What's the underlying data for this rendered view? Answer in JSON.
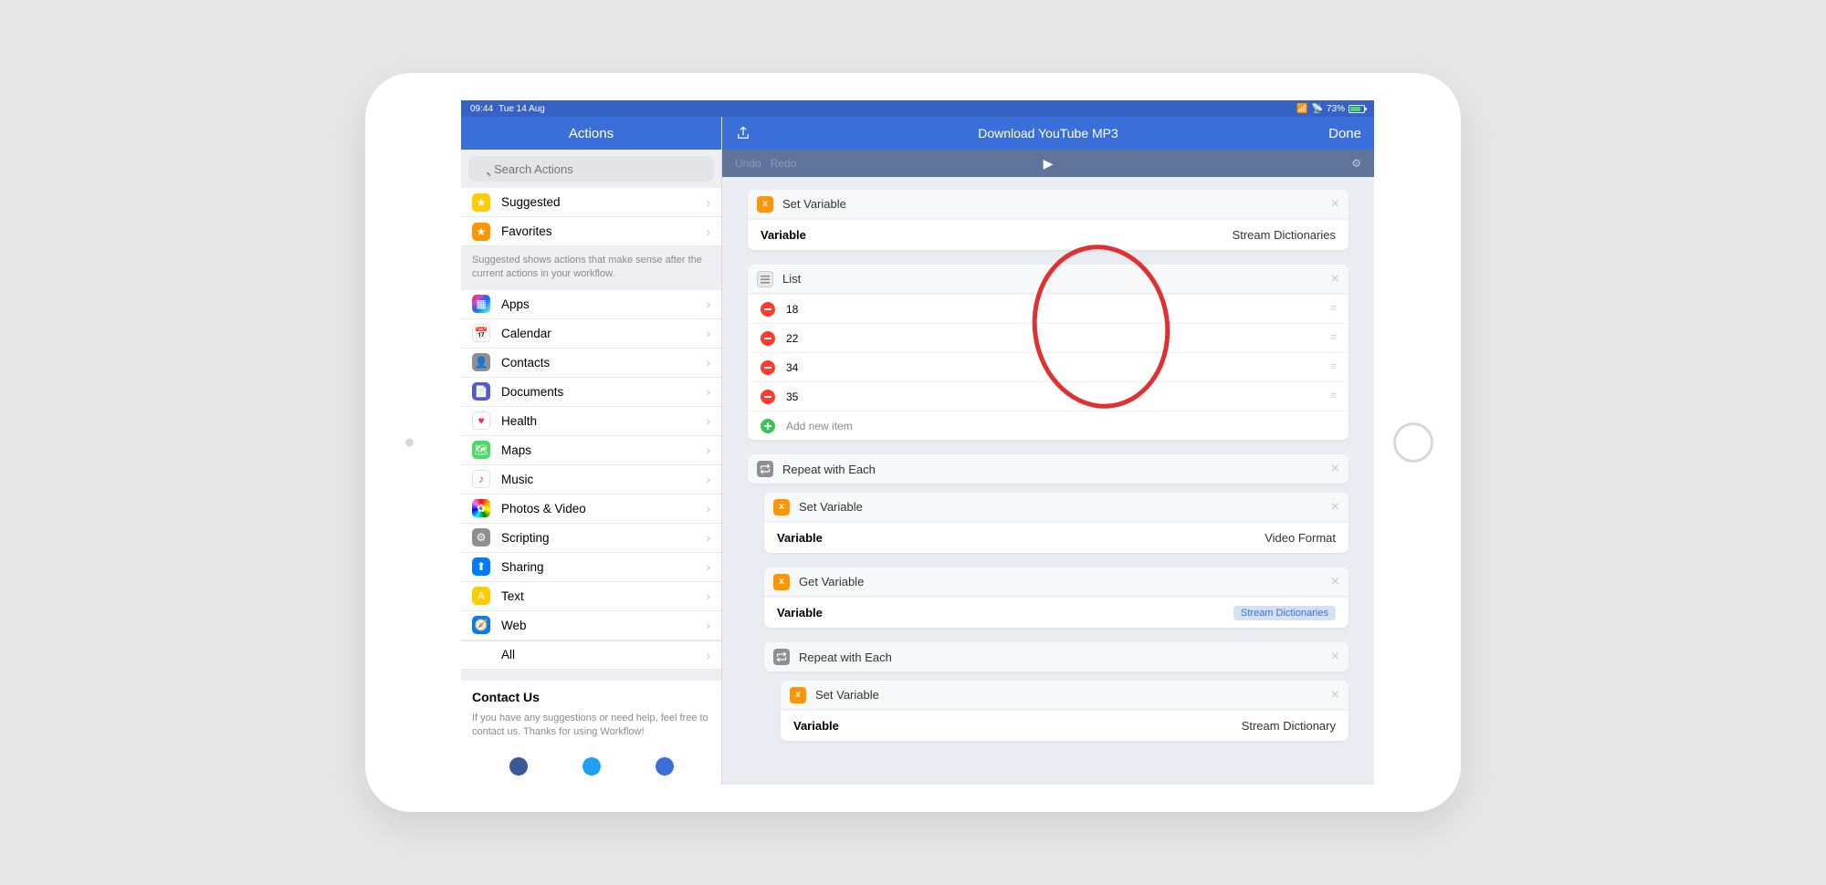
{
  "status": {
    "time": "09:44",
    "date": "Tue 14 Aug",
    "battery": "73%"
  },
  "sidebar": {
    "header": "Actions",
    "search_placeholder": "Search Actions",
    "top": [
      {
        "label": "Suggested",
        "color": "ic-yellow",
        "glyph": "★"
      },
      {
        "label": "Favorites",
        "color": "ic-orange",
        "glyph": "★"
      }
    ],
    "suggested_desc": "Suggested shows actions that make sense after the current actions in your workflow.",
    "categories": [
      {
        "label": "Apps",
        "color": "ic-multi",
        "glyph": "▦"
      },
      {
        "label": "Calendar",
        "color": "ic-white",
        "glyph": "📅"
      },
      {
        "label": "Contacts",
        "color": "ic-gray",
        "glyph": "👤"
      },
      {
        "label": "Documents",
        "color": "ic-purple",
        "glyph": "📄"
      },
      {
        "label": "Health",
        "color": "ic-white",
        "glyph": "♥"
      },
      {
        "label": "Maps",
        "color": "ic-green",
        "glyph": "🗺"
      },
      {
        "label": "Music",
        "color": "ic-white",
        "glyph": "♪"
      },
      {
        "label": "Photos & Video",
        "color": "ic-rainbow",
        "glyph": "✿"
      },
      {
        "label": "Scripting",
        "color": "ic-gray",
        "glyph": "⚙"
      },
      {
        "label": "Sharing",
        "color": "ic-blue",
        "glyph": "⬆"
      },
      {
        "label": "Text",
        "color": "ic-yellow",
        "glyph": "A"
      },
      {
        "label": "Web",
        "color": "ic-blue",
        "glyph": "🧭"
      }
    ],
    "all": "All",
    "contact_title": "Contact Us",
    "contact_desc": "If you have any suggestions or need help, feel free to contact us. Thanks for using Workflow!"
  },
  "header": {
    "title": "Download YouTube MP3",
    "done": "Done"
  },
  "toolbar": {
    "undo": "Undo",
    "redo": "Redo"
  },
  "actions": {
    "set_var_1": {
      "name": "Set Variable",
      "param": "Variable",
      "value": "Stream Dictionaries"
    },
    "list": {
      "name": "List",
      "items": [
        "18",
        "22",
        "34",
        "35"
      ],
      "add": "Add new item"
    },
    "repeat_1": {
      "name": "Repeat with Each"
    },
    "set_var_2": {
      "name": "Set Variable",
      "param": "Variable",
      "value": "Video Format"
    },
    "get_var": {
      "name": "Get Variable",
      "param": "Variable",
      "value": "Stream Dictionaries"
    },
    "repeat_2": {
      "name": "Repeat with Each"
    },
    "set_var_3": {
      "name": "Set Variable",
      "param": "Variable",
      "value": "Stream Dictionary"
    }
  }
}
